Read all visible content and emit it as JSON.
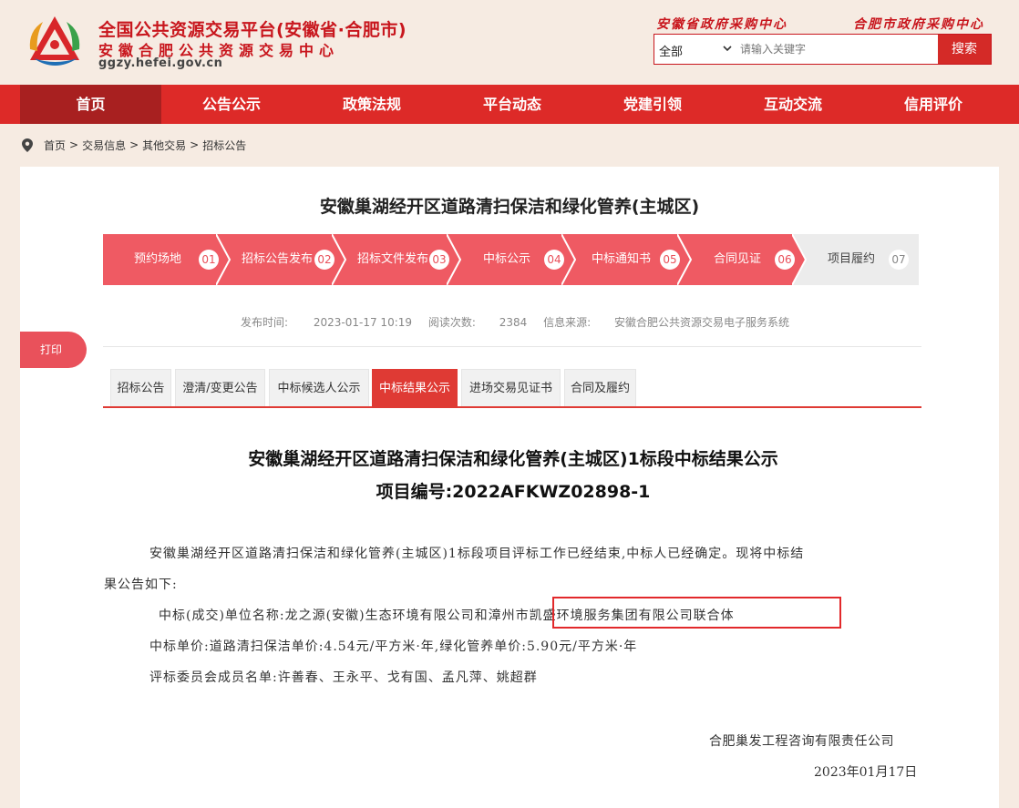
{
  "header": {
    "title_line1": "全国公共资源交易平台(安徽省·合肥市)",
    "title_line2": "安徽合肥公共资源交易中心",
    "domain": "ggzy.hefei.gov.cn",
    "link_province": "安徽省政府采购中心",
    "link_city": "合肥市政府采购中心",
    "search": {
      "selected": "全部",
      "placeholder": "请输入关键字",
      "button": "搜索"
    }
  },
  "nav": {
    "items": [
      "首页",
      "公告公示",
      "政策法规",
      "平台动态",
      "党建引领",
      "互动交流",
      "信用评价"
    ],
    "active_index": 0
  },
  "breadcrumb": [
    "首页",
    "交易信息",
    "其他交易",
    "招标公告"
  ],
  "project_title": "安徽巢湖经开区道路清扫保洁和绿化管养(主城区)",
  "steps": [
    {
      "label": "预约场地",
      "num": "01",
      "done": true
    },
    {
      "label": "招标公告发布",
      "num": "02",
      "done": true
    },
    {
      "label": "招标文件发布",
      "num": "03",
      "done": true
    },
    {
      "label": "中标公示",
      "num": "04",
      "done": true
    },
    {
      "label": "中标通知书",
      "num": "05",
      "done": true
    },
    {
      "label": "合同见证",
      "num": "06",
      "done": true
    },
    {
      "label": "项目履约",
      "num": "07",
      "done": false
    }
  ],
  "meta": {
    "publish_label": "发布时间:",
    "publish_time": "2023-01-17 10:19",
    "views_label": "阅读次数:",
    "views": "2384",
    "source_label": "信息来源:",
    "source": "安徽合肥公共资源交易电子服务系统"
  },
  "print_label": "打印",
  "tabs": [
    "招标公告",
    "澄清/变更公告",
    "中标候选人公示",
    "中标结果公示",
    "进场交易见证书",
    "合同及履约"
  ],
  "active_tab": 3,
  "doc": {
    "title": "安徽巢湖经开区道路清扫保洁和绿化管养(主城区)1标段中标结果公示",
    "code": "项目编号:2022AFKWZ02898-1",
    "para1_line1": "安徽巢湖经开区道路清扫保洁和绿化管养(主城区)1标段项目评标工作已经结束,中标人已经确定。现将中标结",
    "para1_line2": "果公告如下:",
    "winner_label_prefix": "中标(成交)单位名称:龙之源(安徽)生态环境有限公司和",
    "winner_highlight": "漳州市凯盛环境服务集团有限公司联合体",
    "price": "中标单价:道路清扫保洁单价:4.54元/平方米·年,绿化管养单价:5.90元/平方米·年",
    "committee": "评标委员会成员名单:许善春、王永平、戈有国、孟凡萍、姚超群",
    "signer": "合肥巢发工程咨询有限责任公司",
    "date": "2023年01月17日"
  },
  "colors": {
    "brand_red": "#dd2a28",
    "step_pink": "#ef5a63",
    "step_grey": "#ececec",
    "bg": "#f6ebe2"
  }
}
